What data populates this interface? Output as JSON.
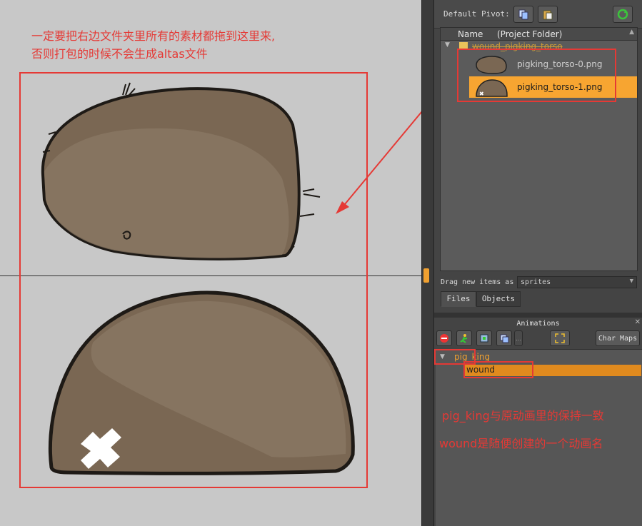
{
  "annotations": {
    "line1": "一定要把右边文件夹里所有的素材都拖到这里来,",
    "line2": "否则打包的时候不会生成altas文件",
    "note_group": "pig_king与原动画里的保持一致",
    "note_anim": "wound是随便创建的一个动画名"
  },
  "toolbar": {
    "pivot_label": "Default Pivot:",
    "icons": [
      "copy-pivot-icon",
      "paste-pivot-icon",
      "refresh-icon"
    ]
  },
  "files_panel": {
    "columns": [
      "Name",
      "(Project Folder)"
    ],
    "folder": "wound_pigking_torso",
    "files": [
      {
        "name": "pigking_torso-0.png",
        "selected": false
      },
      {
        "name": "pigking_torso-1.png",
        "selected": true
      }
    ],
    "drag_label": "Drag new items as",
    "drag_value": "sprites",
    "tabs": [
      "Files",
      "Objects"
    ]
  },
  "animations_panel": {
    "title": "Animations",
    "char_maps_label": "Char Maps",
    "group": "pig_king",
    "animations": [
      "wound"
    ]
  },
  "colors": {
    "annotation_red": "#e53935",
    "selection_orange": "#f7a531",
    "sprite_brown": "#7a6753"
  }
}
